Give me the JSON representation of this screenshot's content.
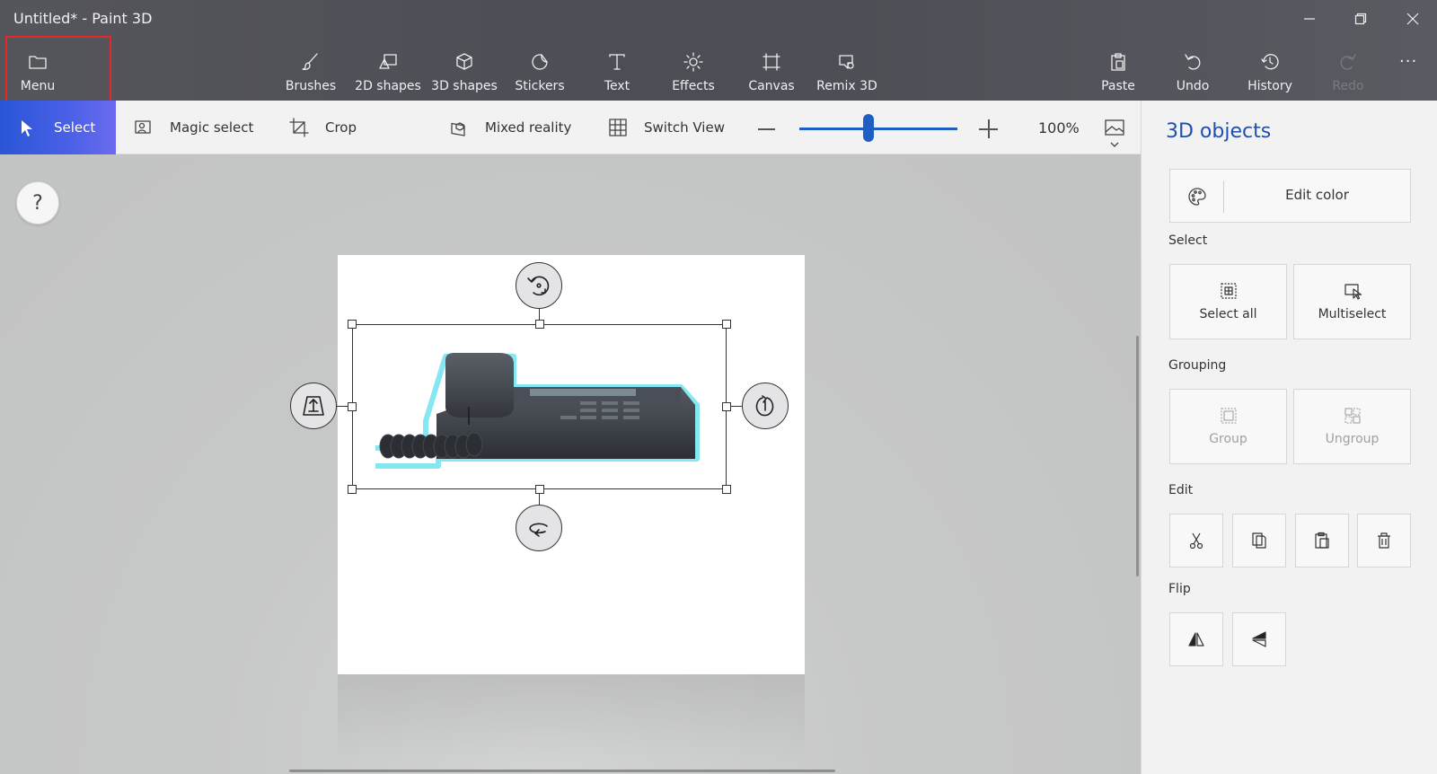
{
  "window": {
    "title": "Untitled* - Paint 3D"
  },
  "ribbon": {
    "menu": "Menu",
    "brushes": "Brushes",
    "shapes_2d": "2D shapes",
    "shapes_3d": "3D shapes",
    "stickers": "Stickers",
    "text": "Text",
    "effects": "Effects",
    "canvas": "Canvas",
    "remix_3d": "Remix 3D",
    "paste": "Paste",
    "undo": "Undo",
    "history": "History",
    "redo": "Redo",
    "more": "···"
  },
  "toolstrip": {
    "select": "Select",
    "magic_select": "Magic select",
    "crop": "Crop",
    "mixed_reality": "Mixed reality",
    "switch_view": "Switch View",
    "zoom_value": "100%",
    "zoom_level": 0.5
  },
  "workspace": {
    "help": "?"
  },
  "panel": {
    "title": "3D objects",
    "edit_color": "Edit color",
    "select_section": "Select",
    "select_all": "Select all",
    "multiselect": "Multiselect",
    "grouping_section": "Grouping",
    "group": "Group",
    "ungroup": "Ungroup",
    "edit_section": "Edit",
    "flip_section": "Flip"
  },
  "colors": {
    "accent": "#1f5fc4",
    "select_gradient_start": "#2a56d6",
    "panel_title": "#1f4fb0",
    "highlight": "#e8262c",
    "object_glow": "#6fe3f0"
  }
}
